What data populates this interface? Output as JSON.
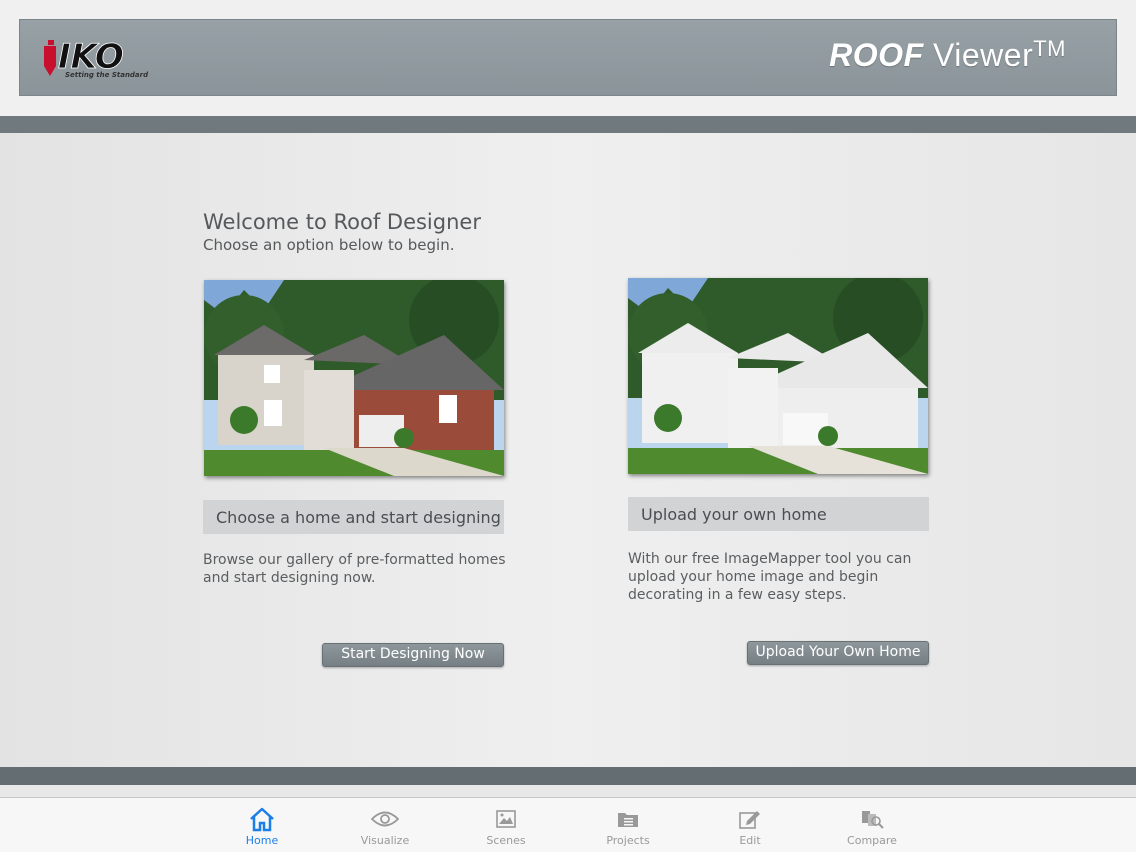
{
  "header": {
    "brand": "IKO",
    "brand_tagline": "Setting the Standard",
    "app_title_bold": "ROOF",
    "app_title_rest": " Viewer",
    "app_title_mark": "TM"
  },
  "welcome": {
    "title": "Welcome to Roof Designer",
    "subtitle": "Choose an option below to begin."
  },
  "cards": [
    {
      "label": "Choose a home and start designing",
      "desc_line1": "Browse our gallery of pre-formatted homes",
      "desc_line2": "and start designing now.",
      "button": "Start Designing Now"
    },
    {
      "label": "Upload your own home",
      "desc_line1": "With our free ImageMapper tool you can",
      "desc_line2": "upload your home image and begin",
      "desc_line3": "decorating in a few easy steps.",
      "button": "Upload Your Own Home"
    }
  ],
  "tabs": [
    {
      "label": "Home",
      "icon": "home-icon",
      "active": true
    },
    {
      "label": "Visualize",
      "icon": "eye-icon"
    },
    {
      "label": "Scenes",
      "icon": "image-icon"
    },
    {
      "label": "Projects",
      "icon": "folder-icon"
    },
    {
      "label": "Edit",
      "icon": "edit-icon"
    },
    {
      "label": "Compare",
      "icon": "compare-icon"
    }
  ],
  "colors": {
    "accent": "#1b7fe8",
    "header_bar": "#8f999e",
    "brand_red": "#c8102e"
  }
}
